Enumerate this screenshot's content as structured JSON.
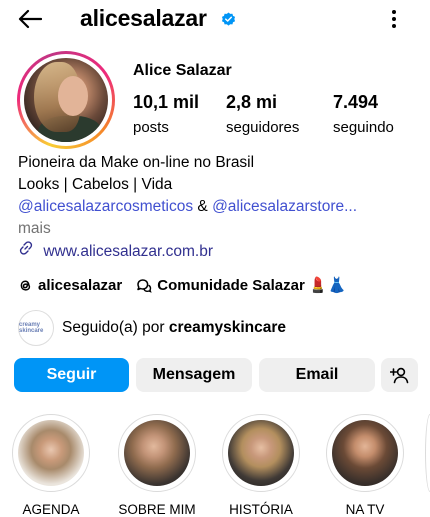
{
  "header": {
    "username": "alicesalazar",
    "verified": true
  },
  "profile": {
    "display_name": "Alice Salazar",
    "stats": [
      {
        "value": "10,1 mil",
        "label": "posts"
      },
      {
        "value": "2,8 mi",
        "label": "seguidores"
      },
      {
        "value": "7.494",
        "label": "seguindo"
      }
    ]
  },
  "bio": {
    "line1": "Pioneira da Make on-line no Brasil",
    "line2": "Looks | Cabelos | Vida",
    "mention1": "@alicesalazarcosmeticos",
    "amp": " & ",
    "mention2": "@alicesalazarstore...",
    "more": "mais",
    "link": "www.alicesalazar.com.br"
  },
  "chips": {
    "threads_label": "alicesalazar",
    "community_label": "Comunidade Salazar",
    "community_emojis": "💄👗"
  },
  "followed_by": {
    "avatar_text": "creamy skincare",
    "prefix": "Seguido(a) por ",
    "name": "creamyskincare"
  },
  "actions": {
    "follow": "Seguir",
    "message": "Mensagem",
    "email": "Email"
  },
  "highlights": [
    {
      "label": "AGENDA"
    },
    {
      "label": "SOBRE MIM"
    },
    {
      "label": "HISTÓRIA"
    },
    {
      "label": "NA TV"
    }
  ],
  "colors": {
    "follow_button": "#0095f6",
    "mention": "#4150d0",
    "verified": "#0095f6"
  }
}
